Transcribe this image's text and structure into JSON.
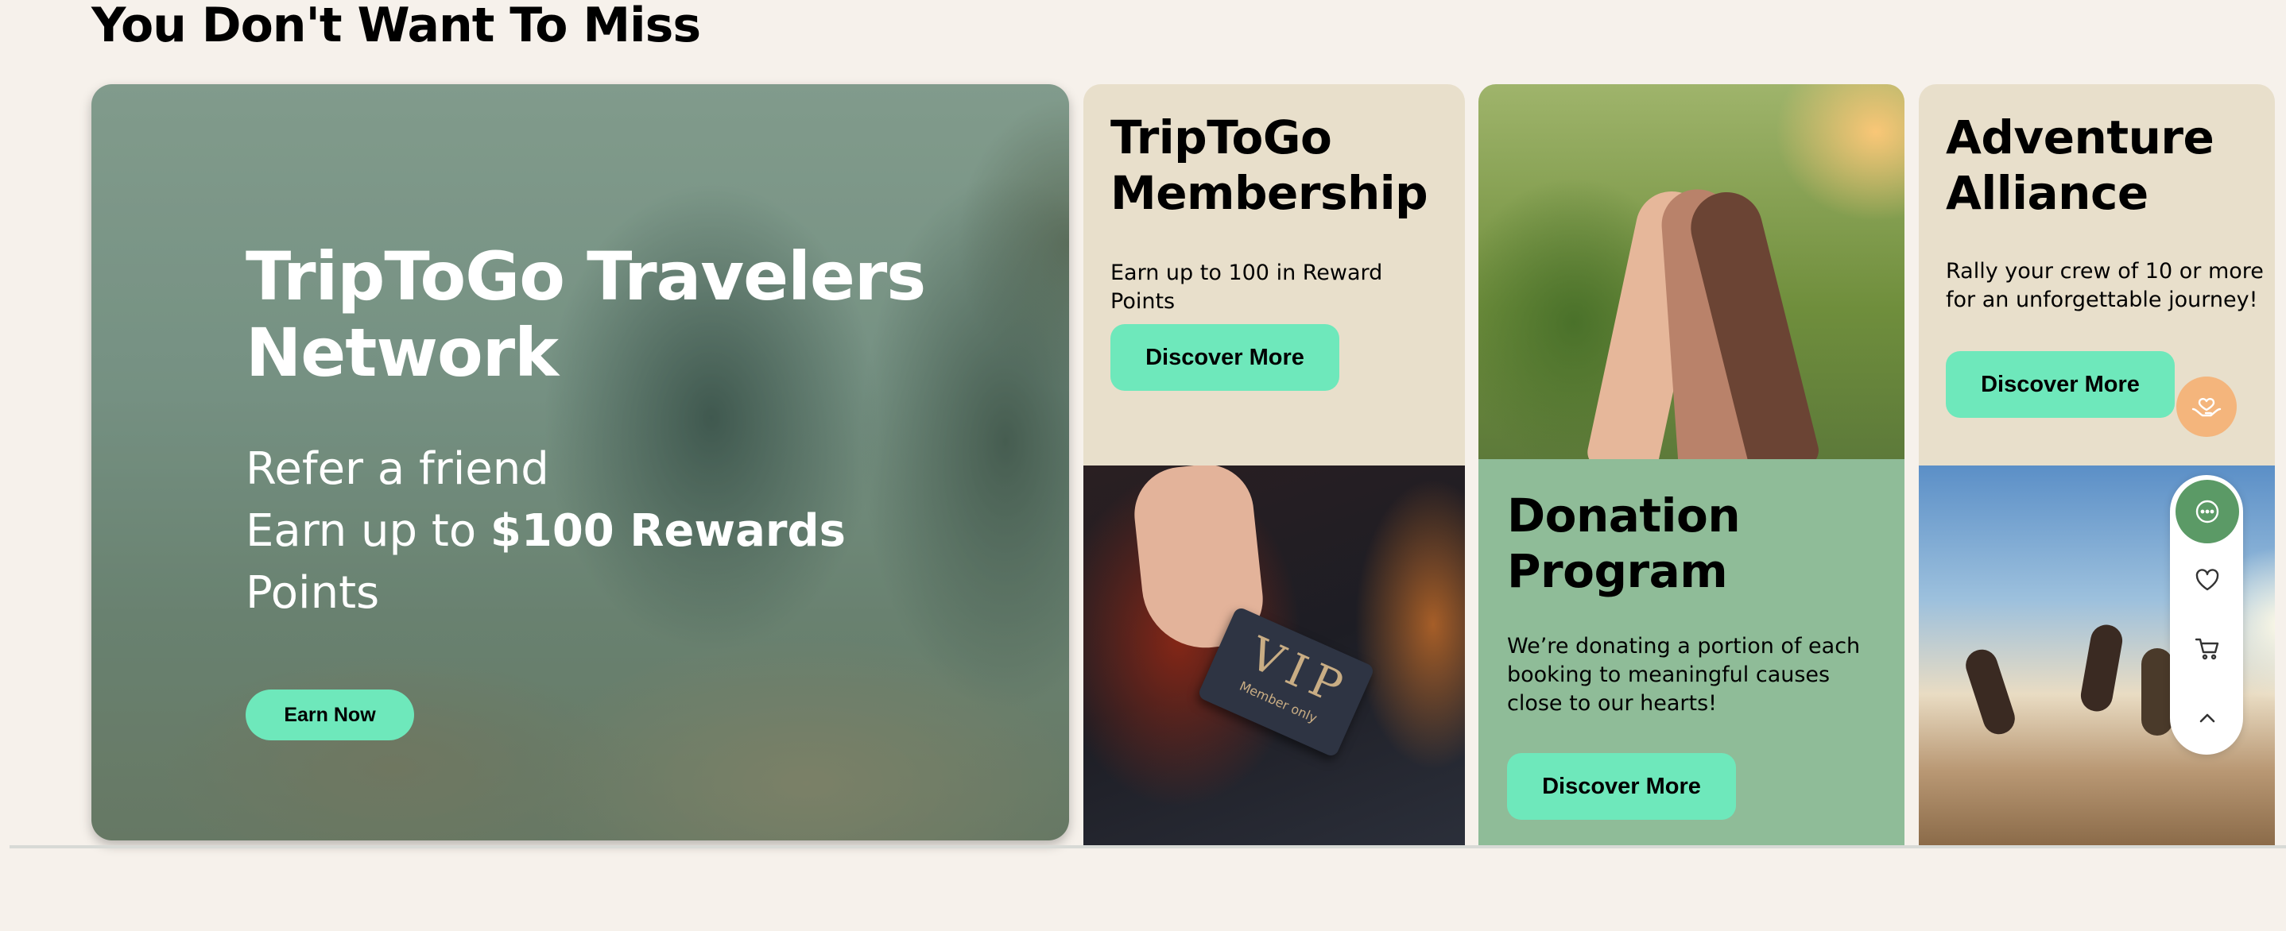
{
  "section": {
    "title": "You Don't Want To Miss"
  },
  "hero": {
    "title": "TripToGo Travelers Network",
    "line1": "Refer a friend",
    "line2_prefix": "Earn up to ",
    "line2_strong": "$100 Rewards",
    "line3": "Points",
    "button": "Earn Now"
  },
  "membership": {
    "title_line1": "TripToGo",
    "title_line2": "Membership",
    "text": "Earn up to 100 in Reward Points",
    "button": "Discover More"
  },
  "vip_card": {
    "big": "VIP",
    "small": "Member only"
  },
  "donation": {
    "title_line1": "Donation",
    "title_line2": "Program",
    "text": "We’re donating a portion of each booking to meaningful causes close to our hearts!",
    "button": "Discover More"
  },
  "adventure": {
    "title_line1": "Adventure",
    "title_line2": "Alliance",
    "text": "Rally your crew of 10 or more for an unforgettable journey!",
    "button": "Discover More"
  },
  "floating": {
    "icons": [
      "chat-icon",
      "heart-icon",
      "cart-icon",
      "chevron-up-icon"
    ],
    "support_icon": "helping-hand-heart-icon"
  },
  "colors": {
    "accent": "#6ee8bb",
    "beige_tile": "#e8dfcb",
    "green_tile": "#8fbc98",
    "page_bg": "#f6f1eb"
  }
}
